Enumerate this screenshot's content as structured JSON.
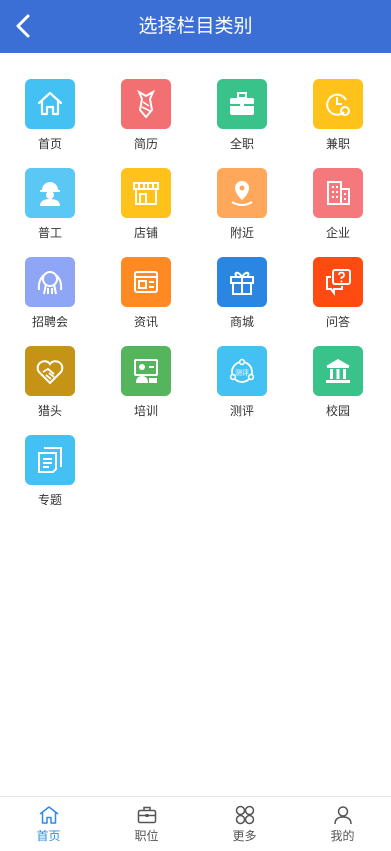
{
  "header": {
    "title": "选择栏目类别"
  },
  "categories": [
    {
      "label": "首页",
      "color": "#43c1f3",
      "icon": "home-icon"
    },
    {
      "label": "简历",
      "color": "#f26f72",
      "icon": "tie-icon"
    },
    {
      "label": "全职",
      "color": "#39c28a",
      "icon": "briefcase-icon"
    },
    {
      "label": "兼职",
      "color": "#ffc21a",
      "icon": "clock-icon"
    },
    {
      "label": "普工",
      "color": "#5bc7f5",
      "icon": "worker-icon"
    },
    {
      "label": "店铺",
      "color": "#ffc21a",
      "icon": "store-icon"
    },
    {
      "label": "附近",
      "color": "#ffa85c",
      "icon": "location-pin-icon"
    },
    {
      "label": "企业",
      "color": "#f5787d",
      "icon": "building-icon"
    },
    {
      "label": "招聘会",
      "color": "#8fa5f5",
      "icon": "people-group-icon"
    },
    {
      "label": "资讯",
      "color": "#ff8a24",
      "icon": "news-icon"
    },
    {
      "label": "商城",
      "color": "#2b86e2",
      "icon": "gift-icon"
    },
    {
      "label": "问答",
      "color": "#ff4b12",
      "icon": "question-bubble-icon"
    },
    {
      "label": "猎头",
      "color": "#c59417",
      "icon": "handshake-heart-icon"
    },
    {
      "label": "培训",
      "color": "#55b55c",
      "icon": "presentation-icon"
    },
    {
      "label": "测评",
      "color": "#43c1f3",
      "icon": "evaluation-icon",
      "badge": "测评"
    },
    {
      "label": "校园",
      "color": "#39c28a",
      "icon": "campus-building-icon"
    },
    {
      "label": "专题",
      "color": "#43c1f3",
      "icon": "topic-document-icon"
    }
  ],
  "tabbar": [
    {
      "label": "首页",
      "icon": "home-icon",
      "active": true
    },
    {
      "label": "职位",
      "icon": "briefcase-icon",
      "active": false
    },
    {
      "label": "更多",
      "icon": "more-grid-icon",
      "active": false
    },
    {
      "label": "我的",
      "icon": "person-icon",
      "active": false
    }
  ],
  "colors": {
    "header": "#3b6fd6",
    "tab_active": "#2f8be3",
    "tab_inactive": "#555555"
  }
}
